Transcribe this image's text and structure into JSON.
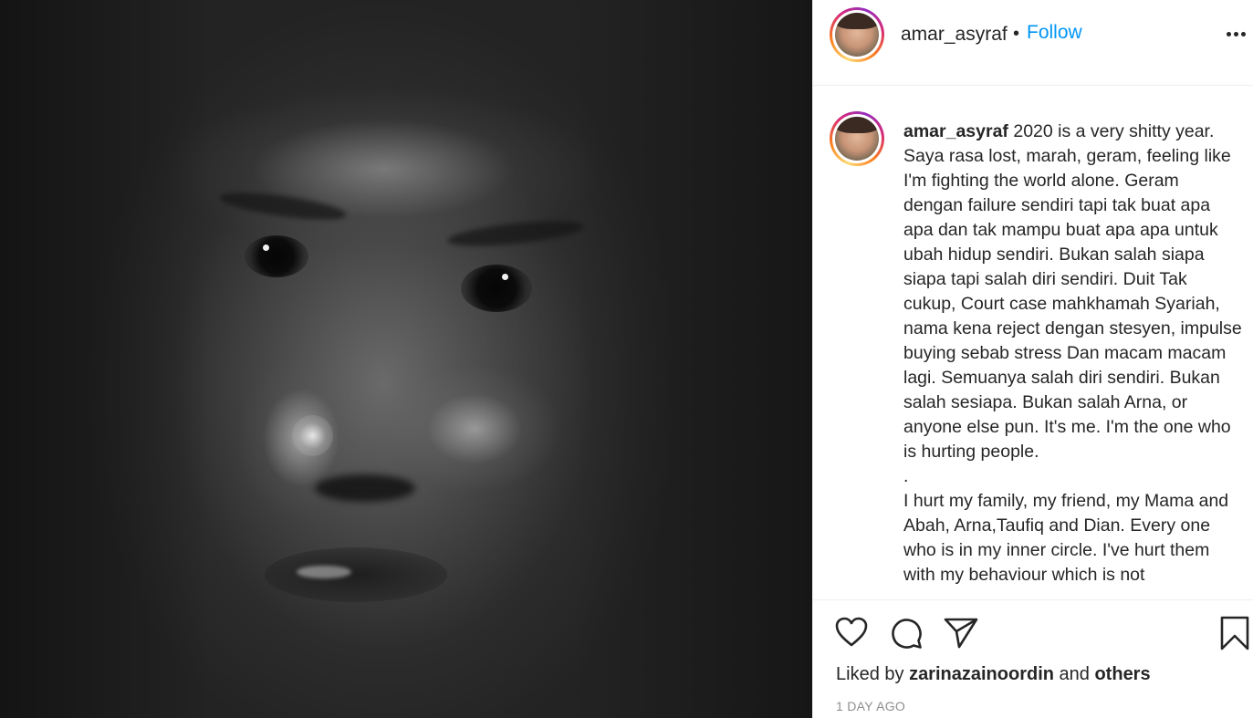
{
  "post": {
    "username": "amar_asyraf",
    "separator": "•",
    "follow_label": "Follow",
    "caption_paragraphs": [
      "2020 is a very shitty year. Saya rasa lost, marah, geram, feeling like I'm fighting the world alone. Geram dengan failure sendiri tapi tak buat apa apa dan tak mampu buat apa apa untuk ubah hidup sendiri. Bukan salah siapa siapa tapi salah diri sendiri. Duit Tak cukup, Court case mahkhamah Syariah, nama kena reject dengan stesyen, impulse buying sebab stress Dan macam macam lagi. Semuanya salah diri sendiri. Bukan salah sesiapa. Bukan salah Arna, or anyone else pun. It's me. I'm the one who is hurting people.",
      ".",
      "I hurt my family, my friend, my Mama and Abah, Arna,Taufiq and Dian. Every one who is in my inner circle. I've hurt them with my behaviour which is not"
    ],
    "liked_by_prefix": "Liked by",
    "liked_by_user": "zarinazainoordin",
    "liked_by_and": "and",
    "liked_by_others": "others",
    "timestamp": "1 DAY AGO"
  },
  "icons": {
    "like": "heart-icon",
    "comment": "comment-icon",
    "share": "paper-plane-icon",
    "save": "bookmark-icon",
    "more": "more-options-icon"
  },
  "colors": {
    "link": "#0095f6",
    "text": "#262626",
    "muted": "#8e8e8e"
  }
}
